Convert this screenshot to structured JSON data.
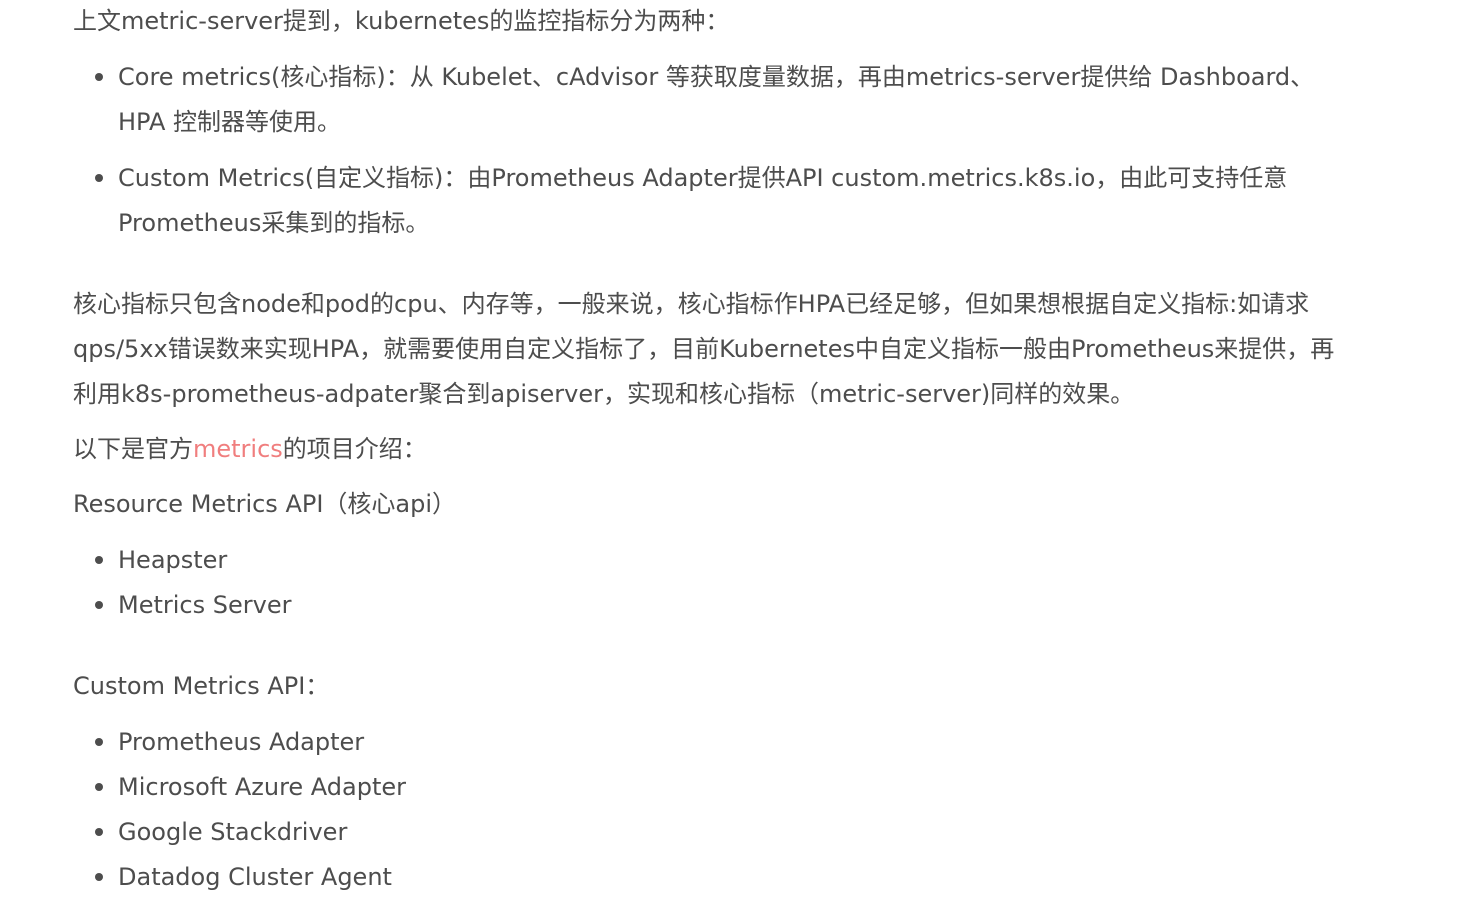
{
  "intro": "上文metric-server提到，kubernetes的监控指标分为两种：",
  "metric_types": [
    {
      "line1": "Core metrics(核心指标)：从 Kubelet、cAdvisor 等获取度量数据，再由metrics-server提供给 Dashboard、",
      "line2": "HPA 控制器等使用。"
    },
    {
      "line1": "Custom Metrics(自定义指标)：由Prometheus Adapter提供API custom.metrics.k8s.io，由此可支持任意",
      "line2": "Prometheus采集到的指标。"
    }
  ],
  "paragraph": {
    "line1": "核心指标只包含node和pod的cpu、内存等，一般来说，核心指标作HPA已经足够，但如果想根据自定义指标:如请求",
    "line2": "qps/5xx错误数来实现HPA，就需要使用自定义指标了，目前Kubernetes中自定义指标一般由Prometheus来提供，再",
    "line3": "利用k8s-prometheus-adpater聚合到apiserver，实现和核心指标（metric-server)同样的效果。"
  },
  "official_intro": {
    "before": "以下是官方",
    "link": "metrics",
    "after": "的项目介绍："
  },
  "resource_api": {
    "heading": "Resource Metrics API（核心api）",
    "items": [
      "Heapster",
      "Metrics Server"
    ]
  },
  "custom_api": {
    "heading": "Custom Metrics API：",
    "items": [
      "Prometheus Adapter",
      "Microsoft Azure Adapter",
      "Google Stackdriver",
      "Datadog Cluster Agent"
    ]
  },
  "colors": {
    "text": "#4d4d4d",
    "link": "#f07e7e",
    "background": "#ffffff"
  }
}
